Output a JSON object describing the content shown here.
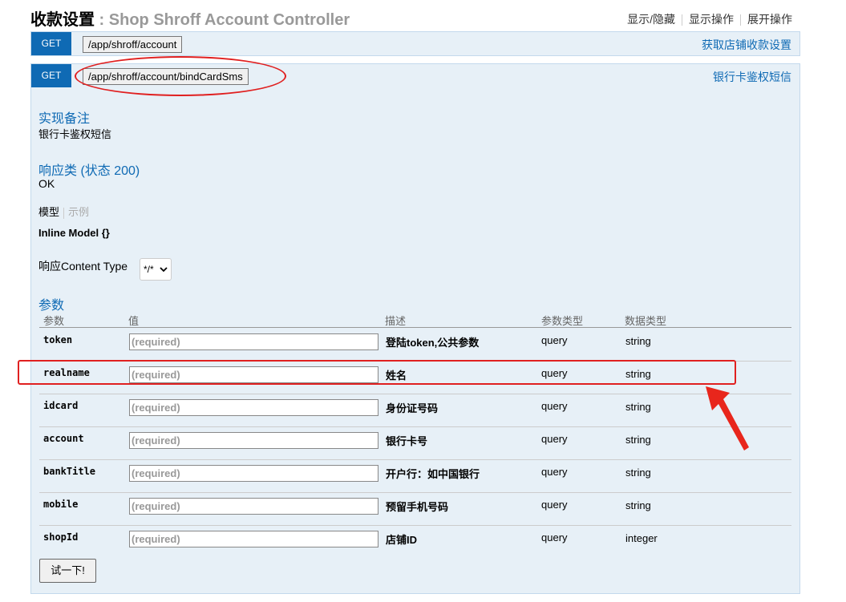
{
  "header": {
    "title_main": "收款设置",
    "title_sep": " : ",
    "title_sub": "Shop Shroff Account Controller",
    "links": [
      "显示/隐藏",
      "显示操作",
      "展开操作"
    ]
  },
  "operations": [
    {
      "method": "GET",
      "path": "/app/shroff/account",
      "summary": "获取店铺收款设置"
    },
    {
      "method": "GET",
      "path": "/app/shroff/account/bindCardSms",
      "summary": "银行卡鉴权短信"
    }
  ],
  "details": {
    "notes_heading": "实现备注",
    "notes_text": "银行卡鉴权短信",
    "response_heading": "响应类 (状态 200)",
    "response_text": "OK",
    "model_tab": "模型",
    "example_tab": "示例",
    "inline_model": "Inline Model {}",
    "content_type_label": "响应Content Type",
    "content_type_value": "*/*"
  },
  "params": {
    "heading": "参数",
    "columns": [
      "参数",
      "值",
      "描述",
      "参数类型",
      "数据类型"
    ],
    "placeholder": "(required)",
    "rows": [
      {
        "name": "token",
        "desc": "登陆token,公共参数",
        "ptype": "query",
        "dtype": "string"
      },
      {
        "name": "realname",
        "desc": "姓名",
        "ptype": "query",
        "dtype": "string"
      },
      {
        "name": "idcard",
        "desc": "身份证号码",
        "ptype": "query",
        "dtype": "string"
      },
      {
        "name": "account",
        "desc": "银行卡号",
        "ptype": "query",
        "dtype": "string"
      },
      {
        "name": "bankTitle",
        "desc": "开户行：如中国银行",
        "ptype": "query",
        "dtype": "string"
      },
      {
        "name": "mobile",
        "desc": "预留手机号码",
        "ptype": "query",
        "dtype": "string"
      },
      {
        "name": "shopId",
        "desc": "店铺ID",
        "ptype": "query",
        "dtype": "integer"
      }
    ]
  },
  "try_button": "试一下!",
  "colors": {
    "verb_get": "#0f6ab4",
    "op_bg": "#e7f0f7",
    "annotation": "#e02020"
  }
}
